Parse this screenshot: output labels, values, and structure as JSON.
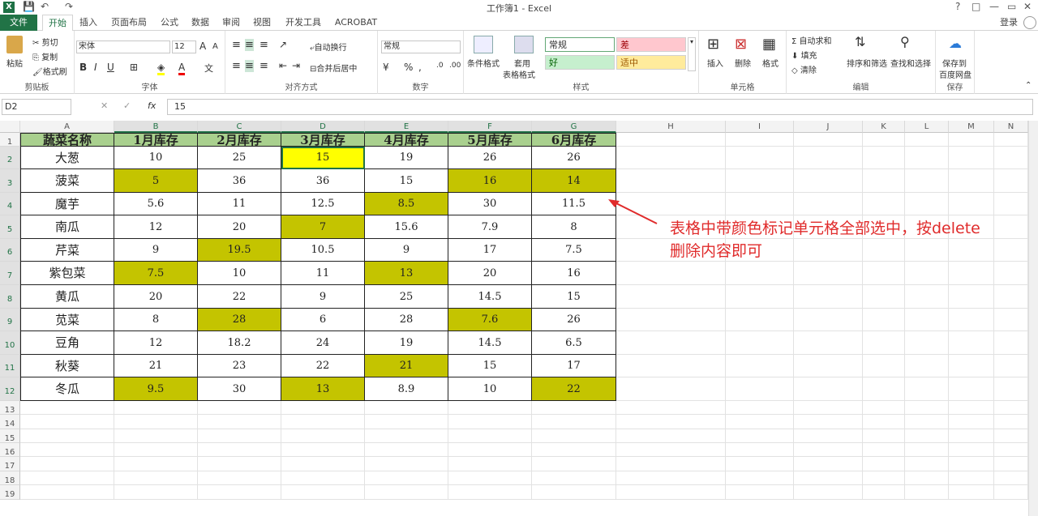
{
  "window": {
    "title": "工作簿1 - Excel",
    "help": "?",
    "controls": [
      "□",
      "—",
      "▭",
      "✕"
    ]
  },
  "tabs": [
    "文件",
    "开始",
    "插入",
    "页面布局",
    "公式",
    "数据",
    "审阅",
    "视图",
    "开发工具",
    "ACROBAT"
  ],
  "login": "登录",
  "ribbon": {
    "clipboard": {
      "paste": "粘贴",
      "cut": "剪切",
      "copy": "复制",
      "painter": "格式刷",
      "label": "剪贴板"
    },
    "font": {
      "name": "宋体",
      "size": "12",
      "bold": "B",
      "italic": "I",
      "underline": "U",
      "grow": "A",
      "shrink": "A",
      "label": "字体"
    },
    "align": {
      "wrap": "自动换行",
      "merge": "合并后居中",
      "label": "对齐方式"
    },
    "number": {
      "format": "常规",
      "percent": "%",
      "comma": ",",
      "label": "数字"
    },
    "styles": {
      "cond": "条件格式",
      "table1": "套用",
      "table2": "表格格式",
      "normal": "常规",
      "bad": "差",
      "good": "好",
      "neutral": "适中",
      "label": "样式"
    },
    "cells": {
      "insert": "插入",
      "delete": "删除",
      "format": "格式",
      "label": "单元格"
    },
    "edit": {
      "autosum": "自动求和",
      "fill": "填充",
      "clear": "清除",
      "sort": "排序和筛选",
      "find": "查找和选择",
      "label": "编辑"
    },
    "save": {
      "l1": "保存到",
      "l2": "百度网盘",
      "label": "保存"
    }
  },
  "formula": {
    "namebox": "D2",
    "fx": "fx",
    "value": "15"
  },
  "columns": [
    "A",
    "B",
    "C",
    "D",
    "E",
    "F",
    "G",
    "H",
    "I",
    "J",
    "K",
    "L",
    "M",
    "N"
  ],
  "rows": [
    "1",
    "2",
    "3",
    "4",
    "5",
    "6",
    "7",
    "8",
    "9",
    "10",
    "11",
    "12",
    "13",
    "14",
    "15",
    "16",
    "17",
    "18",
    "19"
  ],
  "table": {
    "header": [
      "蔬菜名称",
      "1月库存",
      "2月库存",
      "3月库存",
      "4月库存",
      "5月库存",
      "6月库存"
    ],
    "body": [
      [
        "大葱",
        "10",
        "25",
        "15",
        "19",
        "26",
        "26"
      ],
      [
        "菠菜",
        "5",
        "36",
        "36",
        "15",
        "16",
        "14"
      ],
      [
        "魔芋",
        "5.6",
        "11",
        "12.5",
        "8.5",
        "30",
        "11.5"
      ],
      [
        "南瓜",
        "12",
        "20",
        "7",
        "15.6",
        "7.9",
        "8"
      ],
      [
        "芹菜",
        "9",
        "19.5",
        "10.5",
        "9",
        "17",
        "7.5"
      ],
      [
        "紫包菜",
        "7.5",
        "10",
        "11",
        "13",
        "20",
        "16"
      ],
      [
        "黄瓜",
        "20",
        "22",
        "9",
        "25",
        "14.5",
        "15"
      ],
      [
        "苋菜",
        "8",
        "28",
        "6",
        "28",
        "7.6",
        "26"
      ],
      [
        "豆角",
        "12",
        "18.2",
        "24",
        "19",
        "14.5",
        "6.5"
      ],
      [
        "秋葵",
        "21",
        "23",
        "22",
        "21",
        "15",
        "17"
      ],
      [
        "冬瓜",
        "9.5",
        "30",
        "13",
        "8.9",
        "10",
        "22"
      ]
    ],
    "highlighted": [
      [
        0,
        3,
        "#ffff00"
      ],
      [
        1,
        1,
        "#c4c400"
      ],
      [
        1,
        5,
        "#c4c400"
      ],
      [
        1,
        6,
        "#c4c400"
      ],
      [
        2,
        4,
        "#c4c400"
      ],
      [
        3,
        3,
        "#c4c400"
      ],
      [
        4,
        2,
        "#c4c400"
      ],
      [
        5,
        1,
        "#c4c400"
      ],
      [
        5,
        4,
        "#c4c400"
      ],
      [
        7,
        2,
        "#c4c400"
      ],
      [
        7,
        5,
        "#c4c400"
      ],
      [
        9,
        4,
        "#c4c400"
      ],
      [
        10,
        1,
        "#c4c400"
      ],
      [
        10,
        3,
        "#c4c400"
      ],
      [
        10,
        6,
        "#c4c400"
      ]
    ]
  },
  "annotation": {
    "line1": "表格中带颜色标记单元格全部选中，按delete",
    "line2": "删除内容即可",
    "color": "#e02b2b"
  }
}
